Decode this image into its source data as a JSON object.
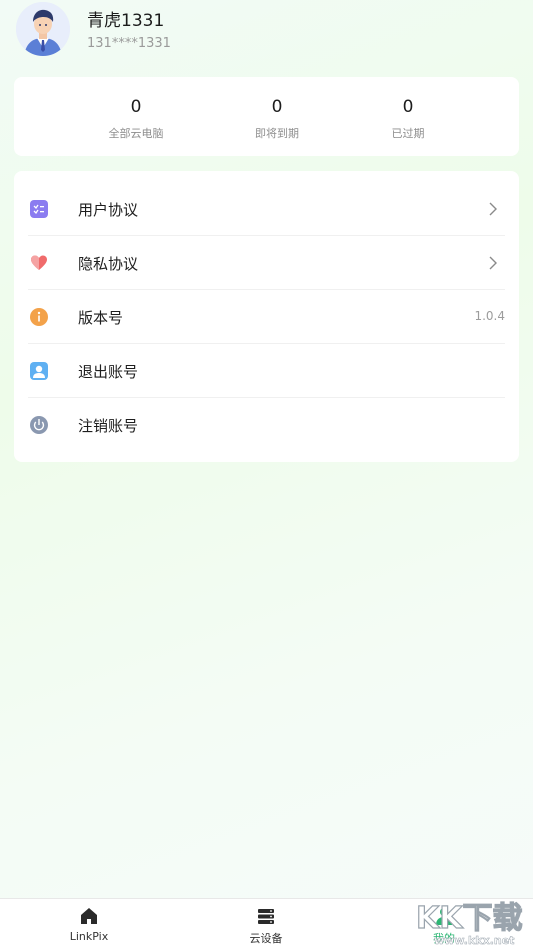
{
  "profile": {
    "username": "青虎1331",
    "phone": "131****1331"
  },
  "stats": [
    {
      "value": "0",
      "label": "全部云电脑"
    },
    {
      "value": "0",
      "label": "即将到期"
    },
    {
      "value": "0",
      "label": "已过期"
    }
  ],
  "menu": [
    {
      "label": "用户协议",
      "icon": "document-icon"
    },
    {
      "label": "隐私协议",
      "icon": "heart-icon"
    },
    {
      "label": "版本号",
      "icon": "info-icon",
      "value": "1.0.4"
    },
    {
      "label": "退出账号",
      "icon": "user-icon"
    },
    {
      "label": "注销账号",
      "icon": "power-icon"
    }
  ],
  "tabs": [
    {
      "label": "LinkPix",
      "icon": "home-icon"
    },
    {
      "label": "云设备",
      "icon": "server-icon"
    },
    {
      "label": "我的",
      "icon": "person-icon",
      "active": true
    }
  ],
  "watermark": "KK下载 www.kkx.net",
  "colors": {
    "accent": "#2bb673",
    "menu_icon_purple": "#8b7cf0",
    "menu_icon_red": "#f06b6b",
    "menu_icon_orange": "#f3a24a",
    "menu_icon_blue": "#5fb0f2",
    "menu_icon_gray": "#8a98b0"
  }
}
